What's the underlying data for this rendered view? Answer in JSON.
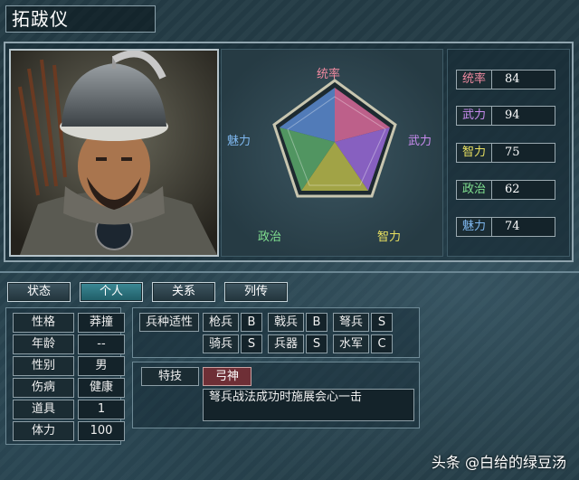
{
  "general": {
    "name": "拓跋仪"
  },
  "radar": {
    "labels": {
      "top": "统率",
      "right": "武力",
      "bottom_right": "智力",
      "bottom_left": "政治",
      "left": "魅力"
    }
  },
  "stats": [
    {
      "label": "统率",
      "value": "84",
      "color": "#f08aa0"
    },
    {
      "label": "武力",
      "value": "94",
      "color": "#c98cf0"
    },
    {
      "label": "智力",
      "value": "75",
      "color": "#e8e060"
    },
    {
      "label": "政治",
      "value": "62",
      "color": "#80e090"
    },
    {
      "label": "魅力",
      "value": "74",
      "color": "#7fb8f0"
    }
  ],
  "tabs": [
    {
      "label": "状态",
      "active": false
    },
    {
      "label": "个人",
      "active": true
    },
    {
      "label": "关系",
      "active": false
    },
    {
      "label": "列传",
      "active": false
    }
  ],
  "personal": [
    {
      "label": "性格",
      "value": "莽撞"
    },
    {
      "label": "年龄",
      "value": "--"
    },
    {
      "label": "性别",
      "value": "男"
    },
    {
      "label": "伤病",
      "value": "健康"
    },
    {
      "label": "道具",
      "value": "1"
    },
    {
      "label": "体力",
      "value": "100"
    }
  ],
  "aptitude": {
    "label": "兵种适性",
    "items": [
      {
        "unit": "枪兵",
        "grade": "B"
      },
      {
        "unit": "戟兵",
        "grade": "B"
      },
      {
        "unit": "弩兵",
        "grade": "S"
      },
      {
        "unit": "骑兵",
        "grade": "S"
      },
      {
        "unit": "兵器",
        "grade": "S"
      },
      {
        "unit": "水军",
        "grade": "C"
      }
    ]
  },
  "skill": {
    "label": "特技",
    "name": "弓神",
    "description": "弩兵战法成功时施展会心一击"
  },
  "watermark": "头条 @白给的绿豆汤",
  "colors": {
    "accent": "#3c8a96",
    "skill_bg": "#6e2f36",
    "border": "#8fa4ae"
  }
}
